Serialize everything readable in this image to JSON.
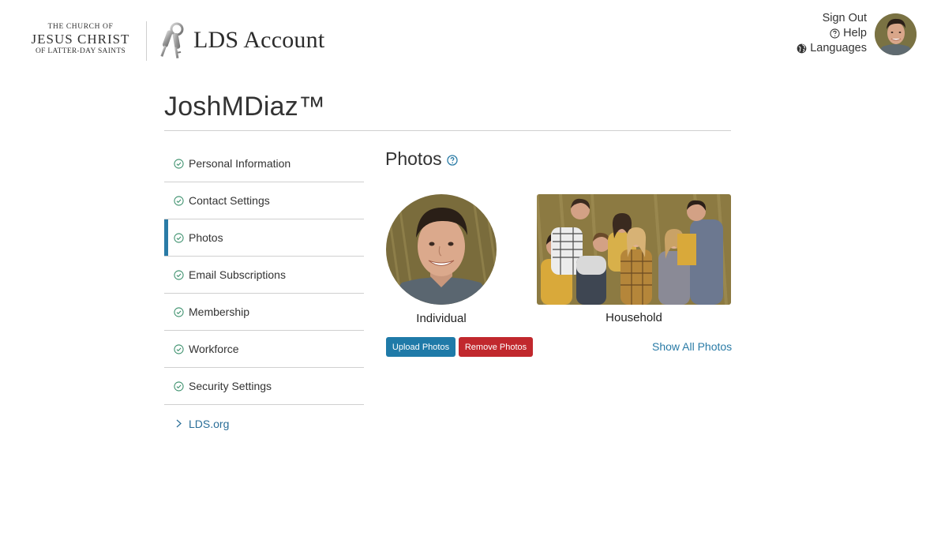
{
  "header": {
    "church_logo": {
      "line1": "THE CHURCH OF",
      "line2": "JESUS CHRIST",
      "line3": "OF LATTER-DAY SAINTS"
    },
    "brand_title": "LDS Account",
    "links": {
      "sign_out": "Sign Out",
      "help": "Help",
      "languages": "Languages"
    }
  },
  "username": "JoshMDiaz™",
  "sidebar": {
    "items": [
      {
        "label": "Personal Information",
        "icon": "check-circle-icon",
        "active": false
      },
      {
        "label": "Contact Settings",
        "icon": "check-circle-icon",
        "active": false
      },
      {
        "label": "Photos",
        "icon": "check-circle-icon",
        "active": true
      },
      {
        "label": "Email Subscriptions",
        "icon": "check-circle-icon",
        "active": false
      },
      {
        "label": "Membership",
        "icon": "check-circle-icon",
        "active": false
      },
      {
        "label": "Workforce",
        "icon": "check-circle-icon",
        "active": false
      },
      {
        "label": "Security Settings",
        "icon": "check-circle-icon",
        "active": false
      }
    ],
    "external_link": {
      "label": "LDS.org",
      "icon": "chevron-right-icon"
    }
  },
  "main": {
    "section_title": "Photos",
    "photos": {
      "individual_caption": "Individual",
      "household_caption": "Household"
    },
    "buttons": {
      "upload": "Upload Photos",
      "remove": "Remove Photos"
    },
    "show_all_link": "Show All Photos"
  },
  "colors": {
    "accent_blue": "#1f7aa8",
    "danger_red": "#c1282d",
    "check_green": "#3a8f6b",
    "link_blue": "#2a7ba6"
  }
}
